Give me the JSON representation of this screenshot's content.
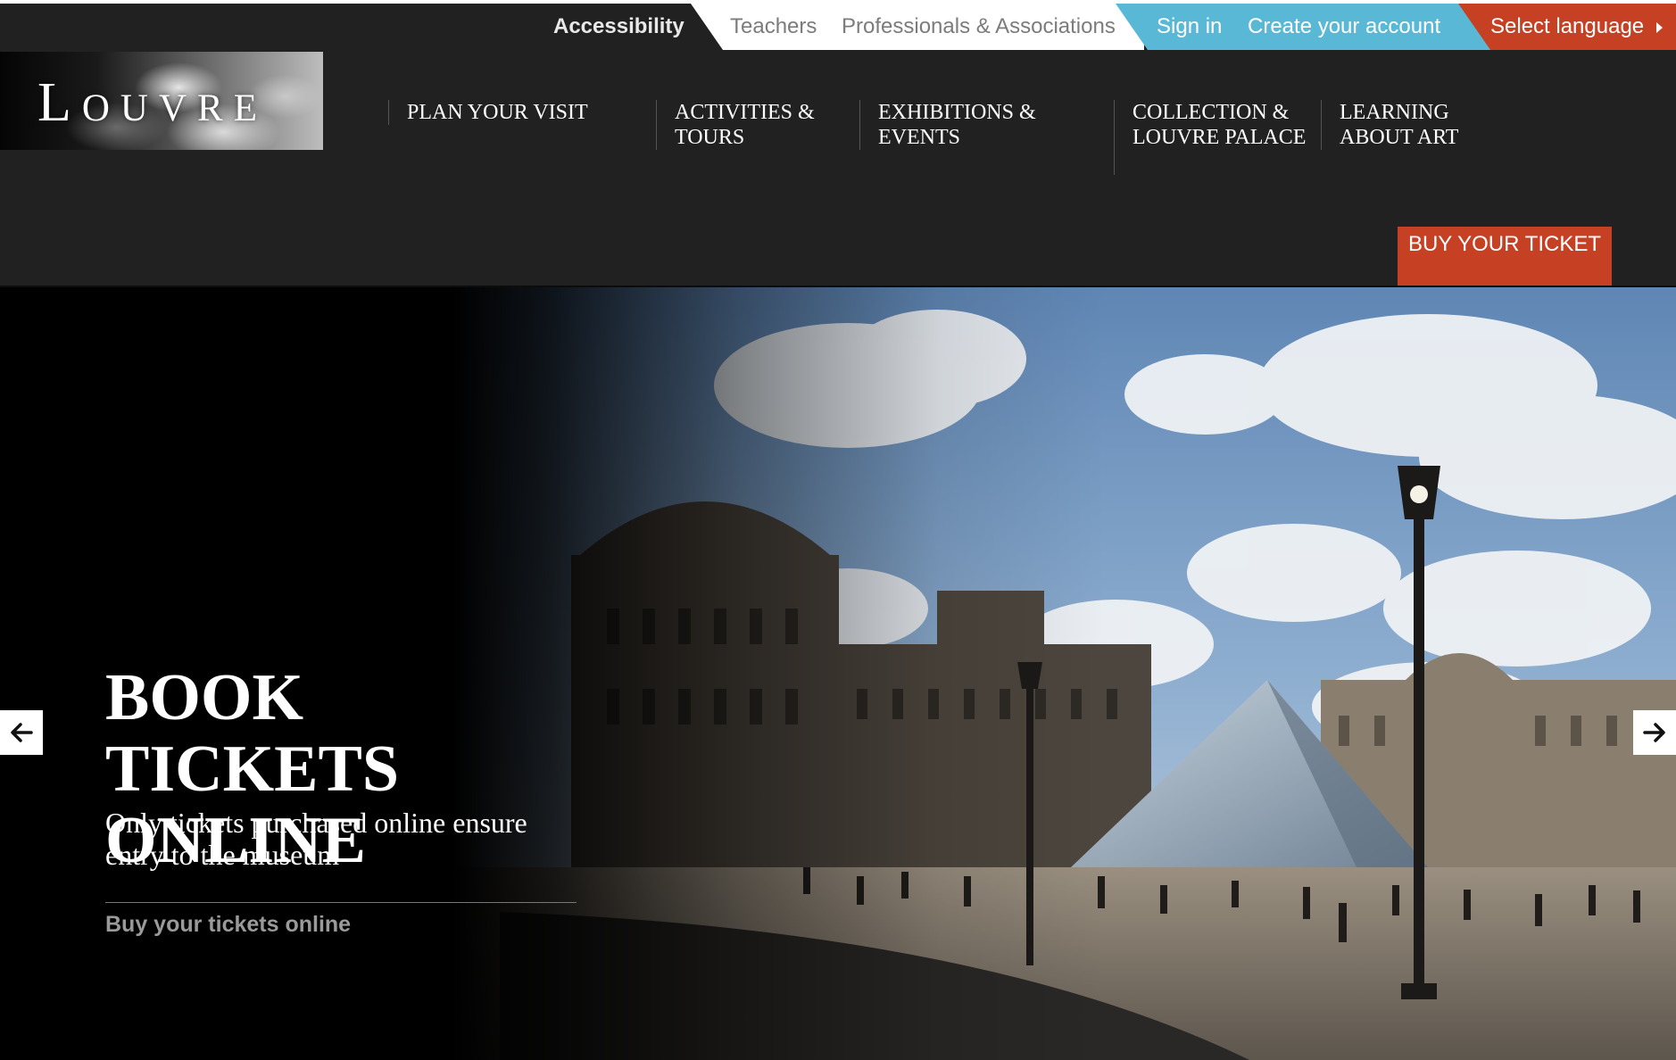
{
  "topbar": {
    "accessibility": "Accessibility",
    "teachers": "Teachers",
    "professionals": "Professionals & Associations",
    "sign_in": "Sign in",
    "create_account": "Create your account",
    "select_language": "Select language"
  },
  "logo": {
    "text": "Louvre"
  },
  "nav": {
    "items": [
      {
        "label": "PLAN YOUR VISIT"
      },
      {
        "label": "ACTIVITIES & TOURS"
      },
      {
        "label": "EXHIBITIONS & EVENTS"
      },
      {
        "label": "COLLECTION & LOUVRE PALACE"
      },
      {
        "label": "LEARNING ABOUT ART"
      }
    ],
    "buy_ticket": "BUY YOUR TICKET"
  },
  "hero": {
    "title": "BOOK TICKETS ONLINE",
    "subtitle": "Only tickets purchased online ensure entry to the museum",
    "link": "Buy your tickets online",
    "prev_icon": "arrow-left-icon",
    "next_icon": "arrow-right-icon"
  },
  "colors": {
    "background": "#212121",
    "accent_red": "#c64124",
    "accent_blue": "#5ab8d7",
    "text_white": "#ffffff",
    "text_gray": "#7c7c7c"
  }
}
